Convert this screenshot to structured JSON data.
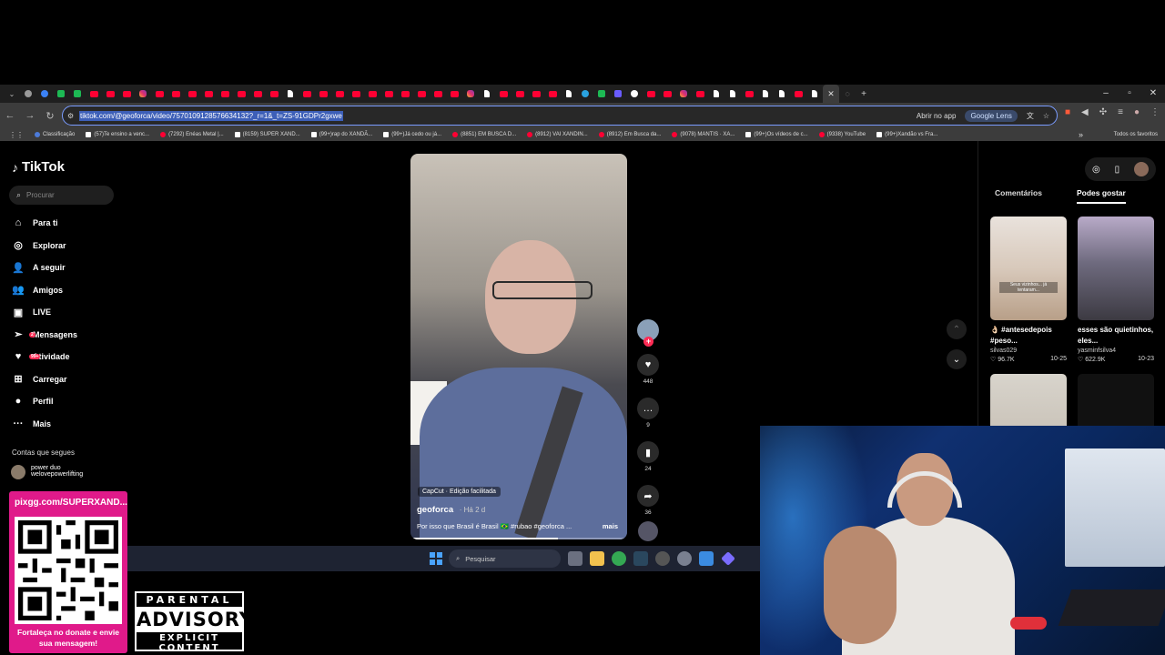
{
  "browser": {
    "url": "tiktok.com/@geoforca/video/7570109128576634132?_r=1&_t=ZS-91GDPr2gxwe",
    "open_in_app": "Abrir no app",
    "lens_label": "Google Lens",
    "tab_favicons": [
      "gy",
      "bl",
      "gr",
      "gr",
      "yt",
      "yt",
      "yt",
      "ig",
      "yt",
      "yt",
      "yt",
      "yt",
      "yt",
      "yt",
      "yt",
      "yt",
      "tt",
      "yt",
      "yt",
      "yt",
      "yt",
      "yt",
      "yt",
      "yt",
      "yt",
      "yt",
      "yt",
      "ig",
      "tt",
      "yt",
      "yt",
      "yt",
      "yt",
      "tt",
      "tg",
      "gr",
      "pu",
      "gg",
      "yt",
      "yt",
      "ig",
      "yt",
      "tt",
      "tt",
      "yt",
      "tt",
      "tt",
      "yt",
      "tt"
    ],
    "bookmarks": [
      {
        "icon": "cls",
        "label": "Classificação"
      },
      {
        "icon": "tt",
        "label": "(57)Te ensino a venc..."
      },
      {
        "icon": "yt",
        "label": "(7292) Enéas Metal |..."
      },
      {
        "icon": "tt",
        "label": "(8159) SUPER XAND..."
      },
      {
        "icon": "tt",
        "label": "(99+)rap do XANDÃ..."
      },
      {
        "icon": "tt",
        "label": "(99+)Já cedo ou já..."
      },
      {
        "icon": "yt",
        "label": "(8851) EM BUSCA D..."
      },
      {
        "icon": "yt",
        "label": "(8912) VAI XANDIN..."
      },
      {
        "icon": "yt",
        "label": "(8912) Em Busca da..."
      },
      {
        "icon": "yt",
        "label": "(9078) MANTIS · XA..."
      },
      {
        "icon": "tt",
        "label": "(99+)Os vídeos de c..."
      },
      {
        "icon": "yt",
        "label": "(9338) YouTube"
      },
      {
        "icon": "tt",
        "label": "(99+)Xandão vs Fra..."
      }
    ],
    "all_bookmarks": "Todos os favoritos"
  },
  "sidebar": {
    "logo": "TikTok",
    "search_placeholder": "Procurar",
    "items": [
      {
        "label": "Para ti",
        "icon": "⌂"
      },
      {
        "label": "Explorar",
        "icon": "◎"
      },
      {
        "label": "A seguir",
        "icon": "👤"
      },
      {
        "label": "Amigos",
        "icon": "👥"
      },
      {
        "label": "LIVE",
        "icon": "▣"
      },
      {
        "label": "Mensagens",
        "icon": "➢",
        "badge": "2"
      },
      {
        "label": "Atividade",
        "icon": "♥",
        "badge": "99+"
      },
      {
        "label": "Carregar",
        "icon": "⊞"
      },
      {
        "label": "Perfil",
        "icon": "●"
      },
      {
        "label": "Mais",
        "icon": "···"
      }
    ],
    "following_title": "Contas que segues",
    "following": [
      {
        "name": "power duo",
        "handle": "welovepowerlifting"
      }
    ]
  },
  "video": {
    "capcut_label": "CapCut · Edição facilitada",
    "username": "geoforca",
    "time": "· Há 2 d",
    "caption": "Por isso que Brasil é Brasil 🇧🇷 #rubao #geoforca ...",
    "more": "mais",
    "progress": 0.68
  },
  "actions": {
    "likes": "448",
    "comments": "9",
    "saves": "24",
    "shares": "36"
  },
  "right_panel": {
    "tabs": [
      "Comentários",
      "Podes gostar"
    ],
    "cards": [
      {
        "title": "👌🏻 #antesedepois #peso...",
        "user": "silvas029",
        "views": "96.7K",
        "date": "10-25",
        "overlay": "Seus vizinhos... já tentaram..."
      },
      {
        "title": "esses são quietinhos, eles...",
        "user": "yasminfsilva4",
        "views": "622.9K",
        "date": "10-23",
        "overlay": ""
      }
    ]
  },
  "taskbar": {
    "search_placeholder": "Pesquisar"
  },
  "overlay": {
    "qr_url": "pixgg.com/SUPERXAND...",
    "qr_text": "Fortaleça no donate e envie sua mensagem!",
    "pa_top": "PARENTAL",
    "pa_mid": "ADVISORY",
    "pa_bot": "EXPLICIT CONTENT"
  }
}
